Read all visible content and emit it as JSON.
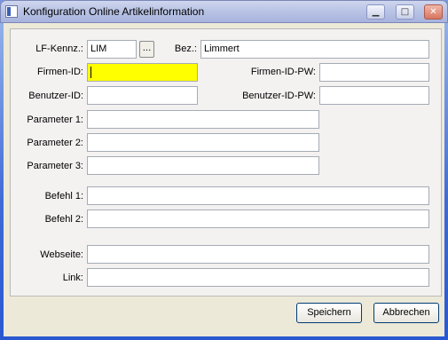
{
  "window": {
    "title": "Konfiguration Online Artikelinformation",
    "controls": {
      "minimize": "▁",
      "maximize": "□",
      "close": "✕"
    }
  },
  "form": {
    "lf_kennz": {
      "label": "LF-Kennz.:",
      "value": "LIM",
      "browse_label": "..."
    },
    "bez": {
      "label": "Bez.:",
      "value": "Limmert"
    },
    "firmen_id": {
      "label": "Firmen-ID:",
      "value": ""
    },
    "firmen_id_pw": {
      "label": "Firmen-ID-PW:",
      "value": ""
    },
    "benutzer_id": {
      "label": "Benutzer-ID:",
      "value": ""
    },
    "benutzer_id_pw": {
      "label": "Benutzer-ID-PW:",
      "value": ""
    },
    "parameter1": {
      "label": "Parameter 1:",
      "value": ""
    },
    "parameter2": {
      "label": "Parameter 2:",
      "value": ""
    },
    "parameter3": {
      "label": "Parameter 3:",
      "value": ""
    },
    "befehl1": {
      "label": "Befehl 1:",
      "value": ""
    },
    "befehl2": {
      "label": "Befehl 2:",
      "value": ""
    },
    "webseite": {
      "label": "Webseite:",
      "value": ""
    },
    "link": {
      "label": "Link:",
      "value": ""
    }
  },
  "buttons": {
    "save": "Speichern",
    "cancel": "Abbrechen"
  },
  "colors": {
    "focused_field": "#ffff00",
    "panel_bg": "#f4f1f1",
    "dialog_bg": "#ece9d8"
  }
}
